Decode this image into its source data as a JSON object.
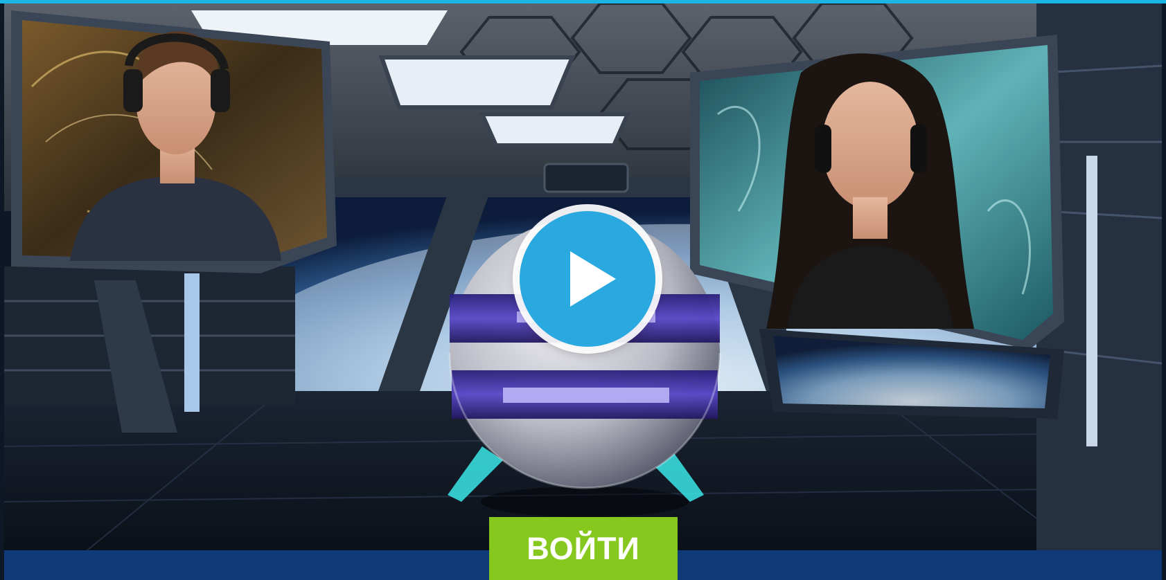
{
  "colors": {
    "accent_strip": "#19b6e6",
    "play_button": "#2aa9e0",
    "login_button": "#86c81e",
    "bottom_bar": "#0f3a78"
  },
  "video": {
    "play_icon": "play-icon"
  },
  "cta": {
    "login_label": "ВОЙТИ"
  }
}
